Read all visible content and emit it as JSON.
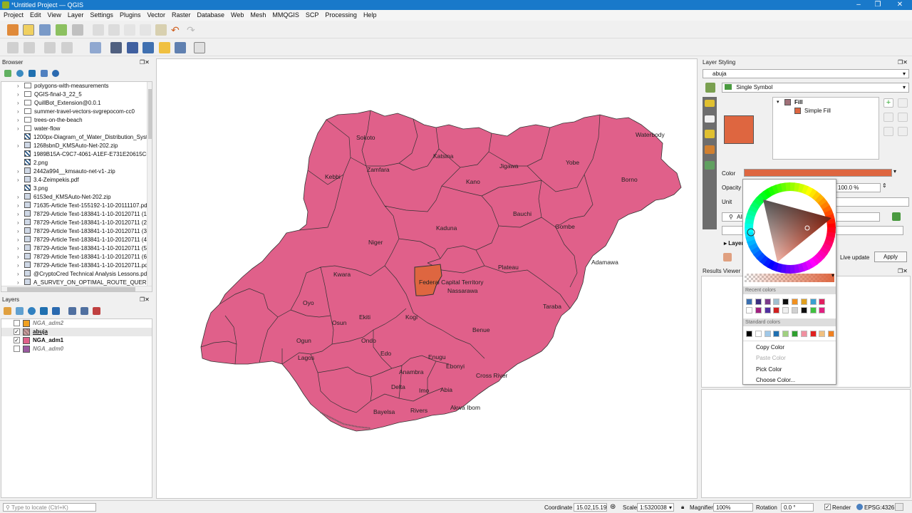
{
  "window": {
    "title": "*Untitled Project — QGIS"
  },
  "menu": [
    "Project",
    "Edit",
    "View",
    "Layer",
    "Settings",
    "Plugins",
    "Vector",
    "Raster",
    "Database",
    "Web",
    "Mesh",
    "MMQGIS",
    "SCP",
    "Processing",
    "Help"
  ],
  "browser": {
    "title": "Browser",
    "items": [
      {
        "label": "polygons-with-measurements",
        "kind": "folder"
      },
      {
        "label": "QGIS-final-3_22_5",
        "kind": "folder"
      },
      {
        "label": "QuillBot_Extension@0.0.1",
        "kind": "folder"
      },
      {
        "label": "summer-travel-vectors-svgrepocom-cc0",
        "kind": "folder"
      },
      {
        "label": "trees-on-the-beach",
        "kind": "folder"
      },
      {
        "label": "water-flow",
        "kind": "folder"
      },
      {
        "label": "1200px-Diagram_of_Water_Distribution_Syst",
        "kind": "raster"
      },
      {
        "label": "1268sbnD_KMSAuto-Net-202.zip",
        "kind": "zip"
      },
      {
        "label": "1989B15A-C9C7-4061-A1EF-E731E20615C5.jp",
        "kind": "raster"
      },
      {
        "label": "2.png",
        "kind": "raster"
      },
      {
        "label": "2442a994__kmsauto-net-v1-.zip",
        "kind": "zip"
      },
      {
        "label": "3.4-Zeimpekis.pdf",
        "kind": "zip"
      },
      {
        "label": "3.png",
        "kind": "raster"
      },
      {
        "label": "6153ed_KMSAuto-Net-202.zip",
        "kind": "zip"
      },
      {
        "label": "71635-Article Text-155192-1-10-20111107.pd",
        "kind": "zip"
      },
      {
        "label": "78729-Article Text-183841-1-10-20120711 (1)",
        "kind": "zip"
      },
      {
        "label": "78729-Article Text-183841-1-10-20120711 (2)",
        "kind": "zip"
      },
      {
        "label": "78729-Article Text-183841-1-10-20120711 (3)",
        "kind": "zip"
      },
      {
        "label": "78729-Article Text-183841-1-10-20120711 (4)",
        "kind": "zip"
      },
      {
        "label": "78729-Article Text-183841-1-10-20120711 (5)",
        "kind": "zip"
      },
      {
        "label": "78729-Article Text-183841-1-10-20120711 (6)",
        "kind": "zip"
      },
      {
        "label": "78729-Article Text-183841-1-10-20120711.pd",
        "kind": "zip"
      },
      {
        "label": "@CryptoCred Technical Analysis Lessons.pdf",
        "kind": "zip"
      },
      {
        "label": "A_SURVEY_ON_OPTIMAL_ROUTE_QUERIES_F",
        "kind": "zip"
      }
    ]
  },
  "layers": {
    "title": "Layers",
    "items": [
      {
        "label": "NGA_adm2",
        "checked": false,
        "color": "#f0a020",
        "style": "italic-grey"
      },
      {
        "label": "abuja",
        "checked": true,
        "color": "#a07878",
        "style": "bold-underline"
      },
      {
        "label": "NGA_adm1",
        "checked": true,
        "color": "#e0608a",
        "style": "bold"
      },
      {
        "label": "NGA_adm0",
        "checked": false,
        "color": "#9a5aa0",
        "style": "italic-grey"
      }
    ]
  },
  "map": {
    "fill": "#e0608a",
    "highlight": "#de6640",
    "labels": [
      "Sokoto",
      "Katsina",
      "Jigawa",
      "Yobe",
      "Waterbody",
      "Borno",
      "Kebbi",
      "Zamfara",
      "Kano",
      "Bauchi",
      "Gombe",
      "Niger",
      "Kaduna",
      "Adamawa",
      "Plateau",
      "Kwara",
      "Federal Capital Territory",
      "Nassarawa",
      "Oyo",
      "Taraba",
      "Osun",
      "Ekiti",
      "Kogi",
      "Benue",
      "Ogun",
      "Ondo",
      "Edo",
      "Enugu",
      "Lagos",
      "Ebonyi",
      "Anambra",
      "Cross River",
      "Delta",
      "Imo",
      "Abia",
      "Akwa Ibom",
      "Bayelsa",
      "Rivers"
    ]
  },
  "styling": {
    "title": "Layer Styling",
    "layer": "abuja",
    "renderer": "Single Symbol",
    "tree_fill": "Fill",
    "tree_simple": "Simple Fill",
    "symbol_color": "#de6640",
    "color_label": "Color",
    "opacity_label": "Opacity",
    "opacity_value": "100.0 %",
    "unit_label": "Unit",
    "search_all": "All",
    "layer_rendering": "Layer",
    "live_update": "Live update",
    "apply": "Apply"
  },
  "results": {
    "title": "Results Viewer"
  },
  "colorpopup": {
    "recent_label": "Recent colors",
    "standard_label": "Standard colors",
    "recent_row1": [
      "#3a6fb0",
      "#3b2f80",
      "#7b3a8a",
      "#a0c0d0",
      "#101010",
      "#f09020",
      "#e0a020",
      "#3aa0d0",
      "#e02060"
    ],
    "recent_row2": [
      "#ffffff",
      "#a02080",
      "#5030a0",
      "#d02020",
      "#f0f0f0",
      "#d0d0d0",
      "#101010",
      "#40c040",
      "#e02080"
    ],
    "standard": [
      "#000000",
      "#ffffff",
      "#a0c8e8",
      "#2070b0",
      "#a0d080",
      "#30a030",
      "#f090a0",
      "#e02020",
      "#f0c080",
      "#f08020"
    ],
    "menu": [
      "Copy Color",
      "Paste Color",
      "Pick Color",
      "Choose Color..."
    ]
  },
  "status": {
    "locate_placeholder": "Type to locate (Ctrl+K)",
    "coordinate_label": "Coordinate",
    "coordinate": "15.02,15.19",
    "scale_label": "Scale",
    "scale": "1:5320038",
    "magnifier_label": "Magnifier",
    "magnifier": "100%",
    "rotation_label": "Rotation",
    "rotation": "0.0 °",
    "render_label": "Render",
    "crs": "EPSG:4326"
  }
}
